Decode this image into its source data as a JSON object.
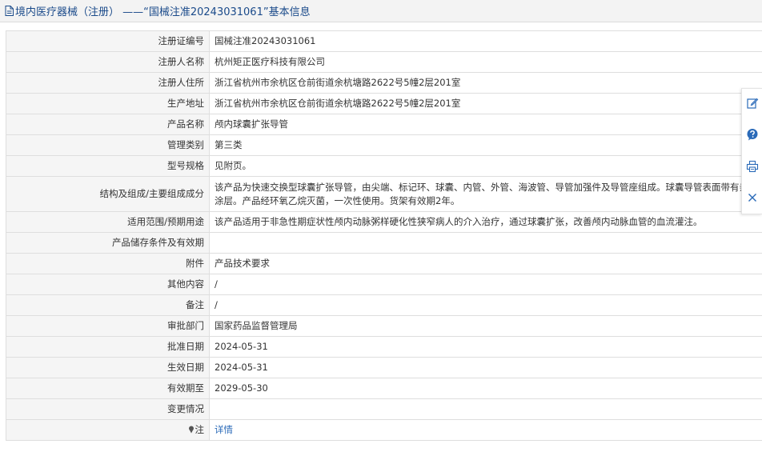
{
  "header": {
    "title": "境内医疗器械（注册） ——“国械注准20243031061”基本信息"
  },
  "rows": [
    {
      "label": "注册证编号",
      "value": "国械注准20243031061"
    },
    {
      "label": "注册人名称",
      "value": "杭州矩正医疗科技有限公司"
    },
    {
      "label": "注册人住所",
      "value": "浙江省杭州市余杭区仓前街道余杭塘路2622号5幢2层201室"
    },
    {
      "label": "生产地址",
      "value": "浙江省杭州市余杭区仓前街道余杭塘路2622号5幢2层201室"
    },
    {
      "label": "产品名称",
      "value": "颅内球囊扩张导管"
    },
    {
      "label": "管理类别",
      "value": "第三类"
    },
    {
      "label": "型号规格",
      "value": "见附页。"
    },
    {
      "label": "结构及组成/主要组成成分",
      "value": "该产品为快速交换型球囊扩张导管，由尖端、标记环、球囊、内管、外管、海波管、导管加强件及导管座组成。球囊导管表面带有亲水涂层。产品经环氧乙烷灭菌，一次性使用。货架有效期2年。"
    },
    {
      "label": "适用范围/预期用途",
      "value": "该产品适用于非急性期症状性颅内动脉粥样硬化性狭窄病人的介入治疗，通过球囊扩张，改善颅内动脉血管的血流灌注。"
    },
    {
      "label": "产品储存条件及有效期",
      "value": ""
    },
    {
      "label": "附件",
      "value": "产品技术要求"
    },
    {
      "label": "其他内容",
      "value": "/"
    },
    {
      "label": "备注",
      "value": "/"
    },
    {
      "label": "审批部门",
      "value": "国家药品监督管理局"
    },
    {
      "label": "批准日期",
      "value": "2024-05-31"
    },
    {
      "label": "生效日期",
      "value": "2024-05-31"
    },
    {
      "label": "有效期至",
      "value": "2029-05-30"
    },
    {
      "label": "变更情况",
      "value": ""
    }
  ],
  "note_row": {
    "label": "注",
    "link_text": "详情"
  },
  "toolbar": {
    "icons": [
      "edit-icon",
      "help-icon",
      "print-icon",
      "close-icon"
    ]
  },
  "colors": {
    "header_text": "#1a4a8a",
    "link": "#2a6ab8",
    "label_bg": "#f5f5f5",
    "border": "#dedede",
    "toolbar_accent": "#2a6ab8"
  }
}
